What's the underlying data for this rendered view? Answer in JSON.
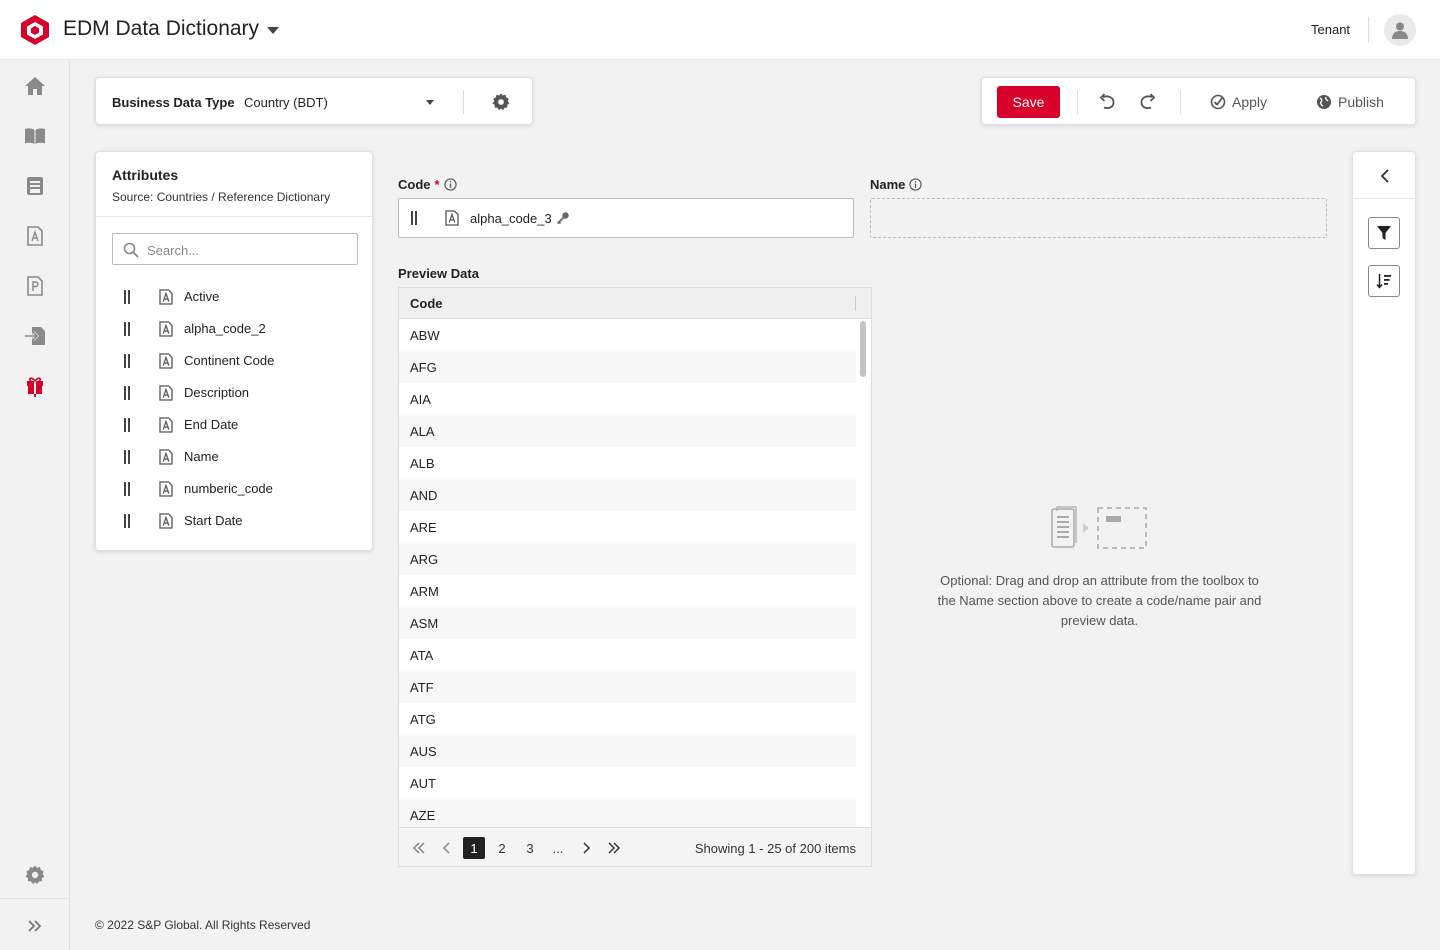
{
  "header": {
    "app_title": "EDM Data Dictionary",
    "tenant": "Tenant"
  },
  "toolbar": {
    "bdt_label": "Business Data Type",
    "bdt_value": "Country (BDT)",
    "save_label": "Save",
    "apply_label": "Apply",
    "publish_label": "Publish"
  },
  "attributes": {
    "title": "Attributes",
    "source": "Source: Countries / Reference Dictionary",
    "search_placeholder": "Search...",
    "items": [
      {
        "label": "Active"
      },
      {
        "label": "alpha_code_2"
      },
      {
        "label": "Continent Code"
      },
      {
        "label": "Description"
      },
      {
        "label": "End Date"
      },
      {
        "label": "Name"
      },
      {
        "label": "numberic_code"
      },
      {
        "label": "Start Date"
      }
    ]
  },
  "fields": {
    "code_label": "Code",
    "code_required_mark": "*",
    "code_value": "alpha_code_3",
    "name_label": "Name"
  },
  "preview": {
    "label": "Preview Data",
    "column": "Code",
    "rows": [
      "ABW",
      "AFG",
      "AIA",
      "ALA",
      "ALB",
      "AND",
      "ARE",
      "ARG",
      "ARM",
      "ASM",
      "ATA",
      "ATF",
      "ATG",
      "AUS",
      "AUT",
      "AZE"
    ],
    "pages": [
      "1",
      "2",
      "3",
      "..."
    ],
    "current_page": "1",
    "info": "Showing 1 - 25 of 200 items"
  },
  "empty_state": {
    "text": "Optional: Drag and drop an attribute from the toolbox to the Name section above to create a code/name pair and preview data."
  },
  "footer": {
    "copyright": "© 2022 S&P Global. All Rights Reserved"
  },
  "colors": {
    "brand_red": "#d6002a",
    "text": "#222222",
    "background": "#f2f2f2"
  },
  "icons": {
    "nav": [
      "home-icon",
      "book-icon",
      "notebook-icon",
      "attribute-doc-icon",
      "p-doc-icon",
      "import-icon",
      "gift-icon",
      "settings-icon",
      "expand-icon"
    ]
  }
}
